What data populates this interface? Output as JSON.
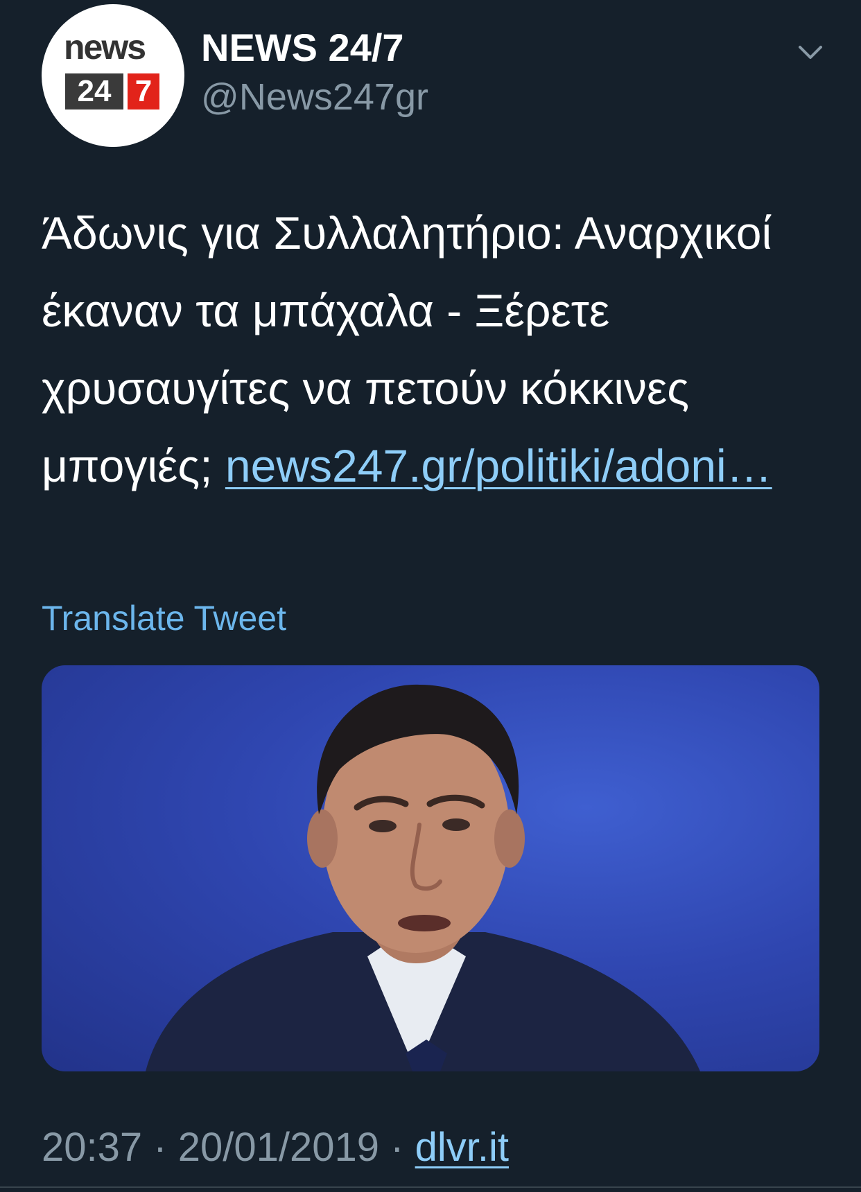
{
  "colors": {
    "background": "#15202b",
    "primary_text": "#ffffff",
    "secondary_text": "#8899a6",
    "link": "#8ecdf8",
    "logo_red": "#e2231a",
    "logo_dark": "#3a3a3a"
  },
  "header": {
    "avatar": {
      "logo_word": "news",
      "logo_num_a": "24",
      "logo_num_b": "7"
    },
    "display_name": "NEWS 24/7",
    "handle": "@News247gr",
    "menu_icon": "chevron-down-icon"
  },
  "tweet": {
    "text": "Άδωνις για Συλλαλητήριο: Αναρχικοί έκαναν τα μπάχαλα - Ξέρετε χρυσαυγίτες να πετούν κόκκινες μπογιές; ",
    "link_text": "news247.gr/politiki/adoni…",
    "translate_label": "Translate Tweet",
    "media_alt": "photo"
  },
  "footer": {
    "time": "20:37",
    "date": "20/01/2019",
    "separator": "·",
    "source": "dlvr.it"
  }
}
